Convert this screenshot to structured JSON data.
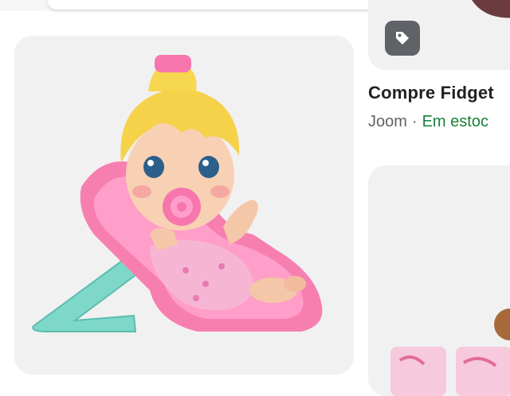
{
  "results": {
    "right_card": {
      "title": "Compre Fidget",
      "store": "Joom",
      "separator": "·",
      "stock_status": "Em estoc",
      "badge_icon": "tag-icon"
    }
  },
  "colors": {
    "card_background": "#f1f1f1",
    "title": "#202124",
    "secondary_text": "#5f6368",
    "in_stock": "#188038",
    "badge_background": "#5f6368"
  }
}
